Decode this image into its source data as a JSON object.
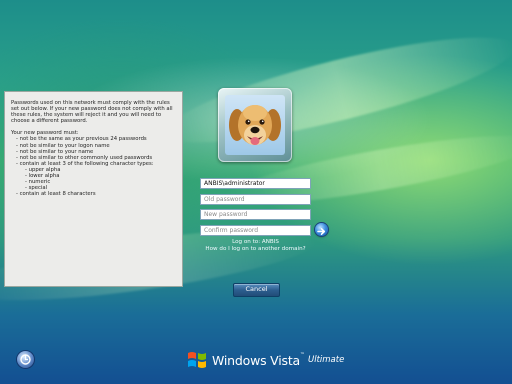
{
  "policy": {
    "intro": "Passwords used on this network must comply with the rules set out below. If your new password does not comply with all these rules, the system will reject it and you will need to choose a different password.",
    "heading": "Your new password must:",
    "rules": [
      "- not be the same as your previous 24 passwords",
      "- not be similar to your logon name",
      "- not be similar to your name",
      "- not be similar to other commonly used passwords",
      "- contain at least 3 of the following character types:"
    ],
    "char_types": [
      "- upper alpha",
      "- lower alpha",
      "- numeric",
      "- special"
    ],
    "final_rule": "- contain at least 8 characters"
  },
  "login": {
    "username_value": "ANBIS\\administrator",
    "old_password_placeholder": "Old password",
    "new_password_placeholder": "New password",
    "confirm_password_placeholder": "Confirm password",
    "logon_to": "Log on to: ANBIS",
    "other_domain_link": "How do I log on to another domain?",
    "cancel_label": "Cancel"
  },
  "branding": {
    "name": "Windows Vista",
    "trademark": "™",
    "edition": "Ultimate"
  },
  "icons": {
    "go": "arrow-right-icon",
    "ease_of_access": "ease-of-access-icon",
    "logo": "windows-flag-logo"
  },
  "colors": {
    "background_top": "#1d8e8a",
    "background_bottom": "#134f92",
    "panel": "#ececea",
    "button": "#2c5e8f"
  }
}
